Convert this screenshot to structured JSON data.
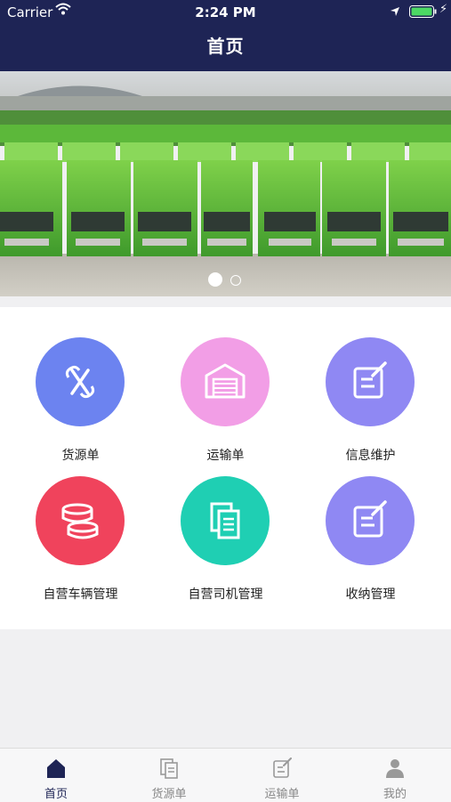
{
  "status_bar": {
    "carrier": "Carrier",
    "time": "2:24 PM"
  },
  "header": {
    "title": "首页"
  },
  "banner": {
    "slide_count": 2,
    "active_slide": 1
  },
  "grid": {
    "items": [
      {
        "label": "货源单",
        "color": "#6c83f0",
        "icon": "link-icon"
      },
      {
        "label": "运输单",
        "color": "#f29ee6",
        "icon": "warehouse-icon"
      },
      {
        "label": "信息维护",
        "color": "#8f88f3",
        "icon": "edit-icon"
      },
      {
        "label": "自营车辆管理",
        "color": "#f0435c",
        "icon": "coins-icon"
      },
      {
        "label": "自营司机管理",
        "color": "#1fcfb3",
        "icon": "documents-icon"
      },
      {
        "label": "收纳管理",
        "color": "#8f88f3",
        "icon": "edit-icon"
      }
    ]
  },
  "tabbar": {
    "tabs": [
      {
        "label": "首页",
        "icon": "home-icon",
        "active": true
      },
      {
        "label": "货源单",
        "icon": "document-icon",
        "active": false
      },
      {
        "label": "运输单",
        "icon": "edit-icon",
        "active": false
      },
      {
        "label": "我的",
        "icon": "user-icon",
        "active": false
      }
    ],
    "active_color": "#1e2455",
    "inactive_color": "#888888"
  }
}
